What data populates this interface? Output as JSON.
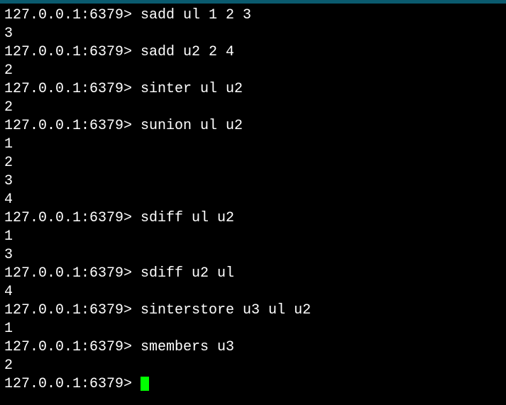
{
  "prompt": "127.0.0.1:6379> ",
  "lines": [
    {
      "type": "cmd",
      "command": "sadd ul 1 2 3"
    },
    {
      "type": "out",
      "text": "3"
    },
    {
      "type": "cmd",
      "command": "sadd u2 2 4"
    },
    {
      "type": "out",
      "text": "2"
    },
    {
      "type": "cmd",
      "command": "sinter ul u2"
    },
    {
      "type": "out",
      "text": "2"
    },
    {
      "type": "cmd",
      "command": "sunion ul u2"
    },
    {
      "type": "out",
      "text": "1"
    },
    {
      "type": "out",
      "text": "2"
    },
    {
      "type": "out",
      "text": "3"
    },
    {
      "type": "out",
      "text": "4"
    },
    {
      "type": "cmd",
      "command": "sdiff ul u2"
    },
    {
      "type": "out",
      "text": "1"
    },
    {
      "type": "out",
      "text": "3"
    },
    {
      "type": "cmd",
      "command": "sdiff u2 ul"
    },
    {
      "type": "out",
      "text": "4"
    },
    {
      "type": "cmd",
      "command": "sinterstore u3 ul u2"
    },
    {
      "type": "out",
      "text": "1"
    },
    {
      "type": "cmd",
      "command": "smembers u3"
    },
    {
      "type": "out",
      "text": "2"
    },
    {
      "type": "cmd",
      "command": "",
      "cursor": true
    }
  ]
}
